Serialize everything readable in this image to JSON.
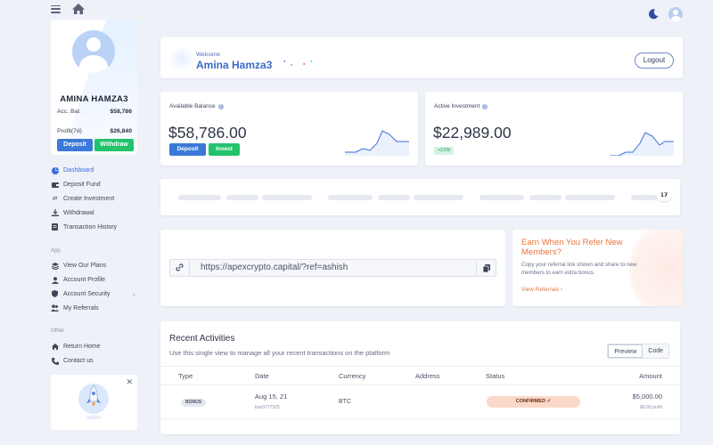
{
  "sidebar": {
    "profile": {
      "name": "AMINA HAMZA3",
      "acc_bal_label": "Acc. Bal.",
      "acc_bal_value": "$58,786",
      "profit_label": "Profit(7d)",
      "profit_value": "$26,840",
      "deposit_label": "Deposit",
      "withdraw_label": "Withdraw"
    },
    "main_nav": [
      {
        "label": "Dashboard",
        "icon": "pie-chart-icon",
        "active": true
      },
      {
        "label": "Deposit Fund",
        "icon": "wallet-icon"
      },
      {
        "label": "Create Investment",
        "icon": "exchange-icon"
      },
      {
        "label": "Withdrawal",
        "icon": "withdraw-icon"
      },
      {
        "label": "Transaction History",
        "icon": "document-icon"
      }
    ],
    "app_section_label": "App",
    "app_nav": [
      {
        "label": "View Our Plans",
        "icon": "stack-icon"
      },
      {
        "label": "Account Profile",
        "icon": "user-icon"
      },
      {
        "label": "Account Security",
        "icon": "shield-icon",
        "has_chevron": true
      },
      {
        "label": "My Referrals",
        "icon": "users-icon"
      }
    ],
    "other_section_label": "Other",
    "other_nav": [
      {
        "label": "Return Home",
        "icon": "home-icon"
      },
      {
        "label": "Contact us",
        "icon": "phone-icon"
      }
    ]
  },
  "header": {
    "welcome_label": "Welcome",
    "welcome_name": "Amina Hamza3",
    "logout_label": "Logout"
  },
  "balance": {
    "label": "Available Balance",
    "amount": "$58,786.00",
    "deposit_label": "Deposit",
    "invest_label": "Invest"
  },
  "investment": {
    "label": "Active Investment",
    "amount": "$22,989.00",
    "change": "+3.5%"
  },
  "referral": {
    "url": "https://apexcrypto.capital/?ref=ashish",
    "promo_title": "Earn When You Refer New Members?",
    "promo_desc": "Copy your referral link shown and share to new members to earn extra bonus.",
    "promo_link": "View Referrals"
  },
  "activities": {
    "title": "Recent Activities",
    "description": "Use this single view to manage all your recent transactions on the platform",
    "tabs": [
      "Preview",
      "Code"
    ],
    "columns": [
      "Type",
      "Date",
      "Currency",
      "Address",
      "Status",
      "Amount"
    ],
    "rows": [
      {
        "type": "BONUS",
        "date": "Aug 15, 21",
        "ref": "bon3777925",
        "currency": "BTC",
        "address": "",
        "status": "CONFIRMED ✓",
        "amount": "$5,000.00",
        "profit": "$0.00 profit"
      }
    ]
  },
  "colors": {
    "primary": "#3a79d7",
    "success": "#22c36b",
    "accent_orange": "#e8753f",
    "background": "#eef1f8"
  }
}
